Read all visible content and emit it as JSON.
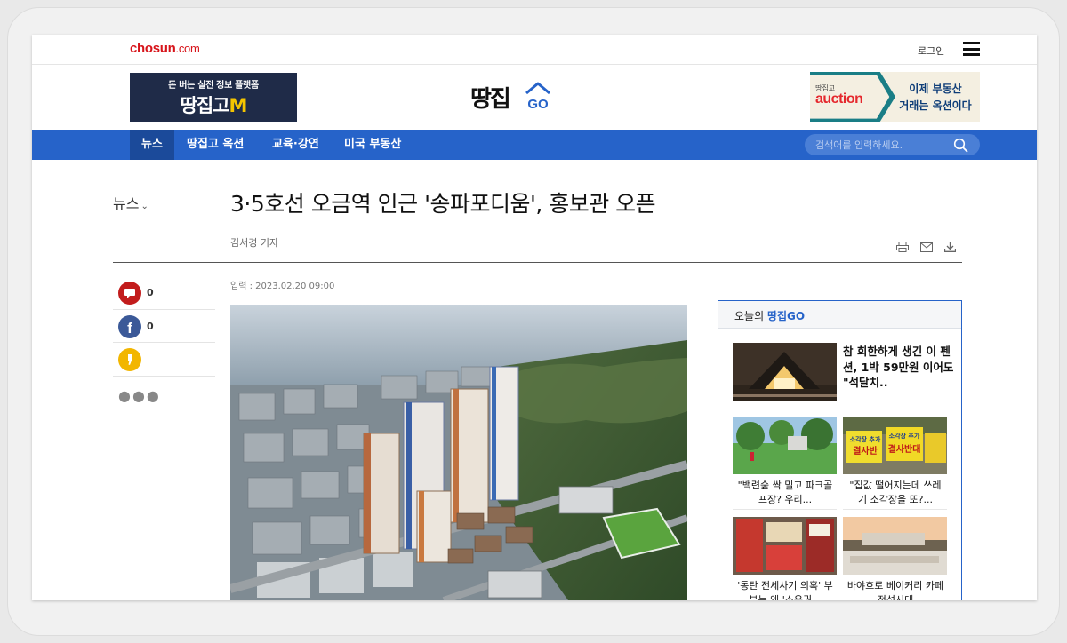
{
  "topbar": {
    "logo": "chosun",
    "logo_suffix": ".com",
    "login": "로그인"
  },
  "header": {
    "banner_left_line1": "돈 버는 실전 정보 플랫폼",
    "banner_left_line2": "땅집고",
    "banner_left_line2_accent": "M",
    "site_logo_text": "땅집",
    "site_logo_go": "GO",
    "banner_right_small": "땅집고",
    "banner_right_brand": "auction",
    "banner_right_line1": "이제 부동산",
    "banner_right_line2": "거래는 옥션이다"
  },
  "nav": {
    "items": [
      {
        "label": "뉴스"
      },
      {
        "label": "땅집고 옥션"
      },
      {
        "label": "교육·강연"
      },
      {
        "label": "미국 부동산"
      }
    ],
    "search_placeholder": "검색어를 입력하세요."
  },
  "article": {
    "section": "뉴스",
    "headline": "3·5호선 오금역 인근 '송파포디움', 홍보관 오픈",
    "byline": "김서경 기자",
    "input_date": "입력 : 2023.02.20 09:00"
  },
  "social": {
    "comment_count": "0",
    "facebook_count": "0"
  },
  "sidebar": {
    "heading_prefix": "오늘의 ",
    "heading_brand": "땅집GO",
    "lead_title": "참 희한하게 생긴 이 펜션, 1박 59만원 이어도 \"석달치..",
    "cards": [
      {
        "title": "\"백련숲 싹 밀고 파크골프장? 우리..."
      },
      {
        "title": "\"집값 떨어지는데 쓰레기 소각장을 또?..."
      },
      {
        "title": "'동탄 전세사기 의혹' 부부는 왜 '소유권..."
      },
      {
        "title": "바야흐로 베이커리 카페 전성시대"
      }
    ],
    "protest_sign": "소각장 추가\n결사반대"
  },
  "colors": {
    "nav_blue": "#2663c9",
    "nav_active": "#1b4a9a",
    "chosun_red": "#d7141a",
    "auction_red": "#e5282d"
  }
}
